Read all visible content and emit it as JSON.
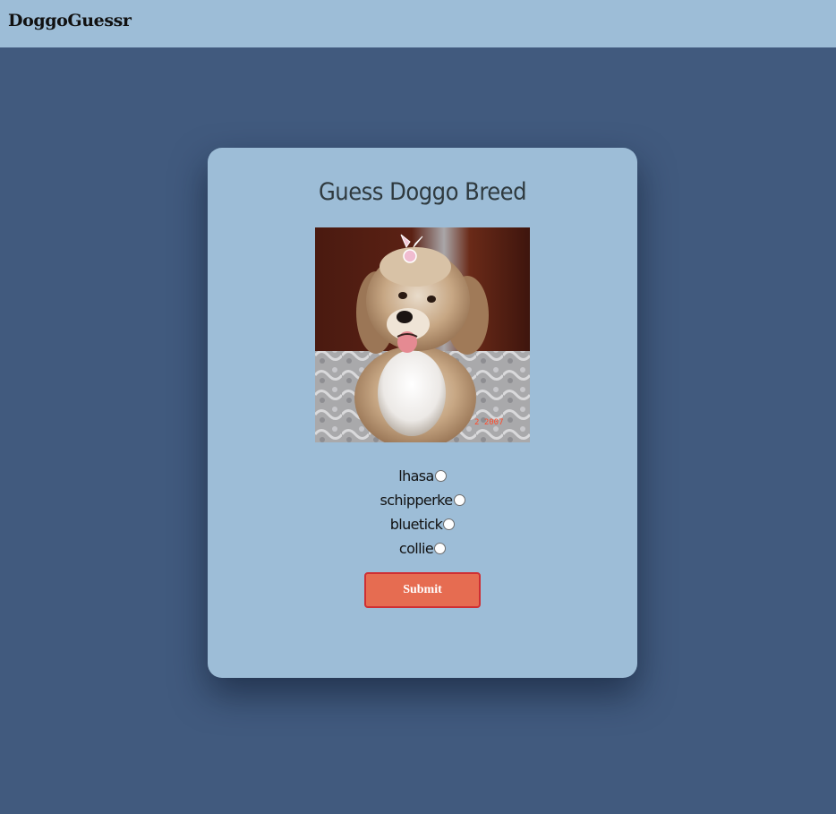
{
  "header": {
    "brand": "DoggoGuessr"
  },
  "card": {
    "title": "Guess Doggo Breed",
    "photo_date_stamp": "2 2007",
    "options": [
      {
        "label": "lhasa",
        "selected": false
      },
      {
        "label": "schipperke",
        "selected": false
      },
      {
        "label": "bluetick",
        "selected": false
      },
      {
        "label": "collie",
        "selected": false
      }
    ],
    "submit_label": "Submit"
  },
  "colors": {
    "page_background": "#415a7e",
    "header_background": "#9dbdd7",
    "card_background": "#9dbdd7",
    "submit_background": "#e66c51",
    "submit_border": "#cf2f33"
  }
}
